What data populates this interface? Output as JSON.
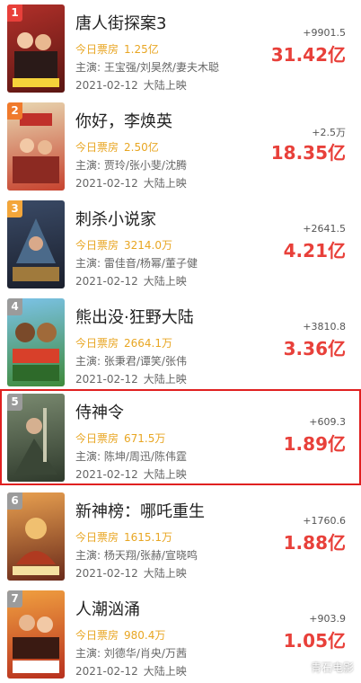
{
  "colors": {
    "rank_1": "#e8403a",
    "rank_2": "#f07a2c",
    "rank_3": "#f3a63a",
    "rank_other": "#9b9b9b",
    "today_label": "#e8a623",
    "total": "#e8403a",
    "highlight_border": "#e02020"
  },
  "today_label": "今日票房",
  "release_region": "大陆上映",
  "watermark": "青石电影",
  "movies": [
    {
      "rank": "1",
      "title": "唐人街探案3",
      "today": "1.25亿",
      "cast": "主演: 王宝强/刘昊然/妻夫木聪",
      "release_date": "2021-02-12",
      "delta": "+9901.5",
      "total": "31.42亿"
    },
    {
      "rank": "2",
      "title": "你好，李焕英",
      "today": "2.50亿",
      "cast": "主演: 贾玲/张小斐/沈腾",
      "release_date": "2021-02-12",
      "delta": "+2.5万",
      "total": "18.35亿"
    },
    {
      "rank": "3",
      "title": "刺杀小说家",
      "today": "3214.0万",
      "cast": "主演: 雷佳音/杨幂/董子健",
      "release_date": "2021-02-12",
      "delta": "+2641.5",
      "total": "4.21亿"
    },
    {
      "rank": "4",
      "title": "熊出没·狂野大陆",
      "today": "2664.1万",
      "cast": "主演: 张秉君/谭笑/张伟",
      "release_date": "2021-02-12",
      "delta": "+3810.8",
      "total": "3.36亿"
    },
    {
      "rank": "5",
      "title": "侍神令",
      "today": "671.5万",
      "cast": "主演: 陈坤/周迅/陈伟霆",
      "release_date": "2021-02-12",
      "delta": "+609.3",
      "total": "1.89亿",
      "highlighted": true
    },
    {
      "rank": "6",
      "title": "新神榜：哪吒重生",
      "today": "1615.1万",
      "cast": "主演: 杨天翔/张赫/宣晓鸣",
      "release_date": "2021-02-12",
      "delta": "+1760.6",
      "total": "1.88亿"
    },
    {
      "rank": "7",
      "title": "人潮汹涌",
      "today": "980.4万",
      "cast": "主演: 刘德华/肖央/万茜",
      "release_date": "2021-02-12",
      "delta": "+903.9",
      "total": "1.05亿"
    }
  ]
}
